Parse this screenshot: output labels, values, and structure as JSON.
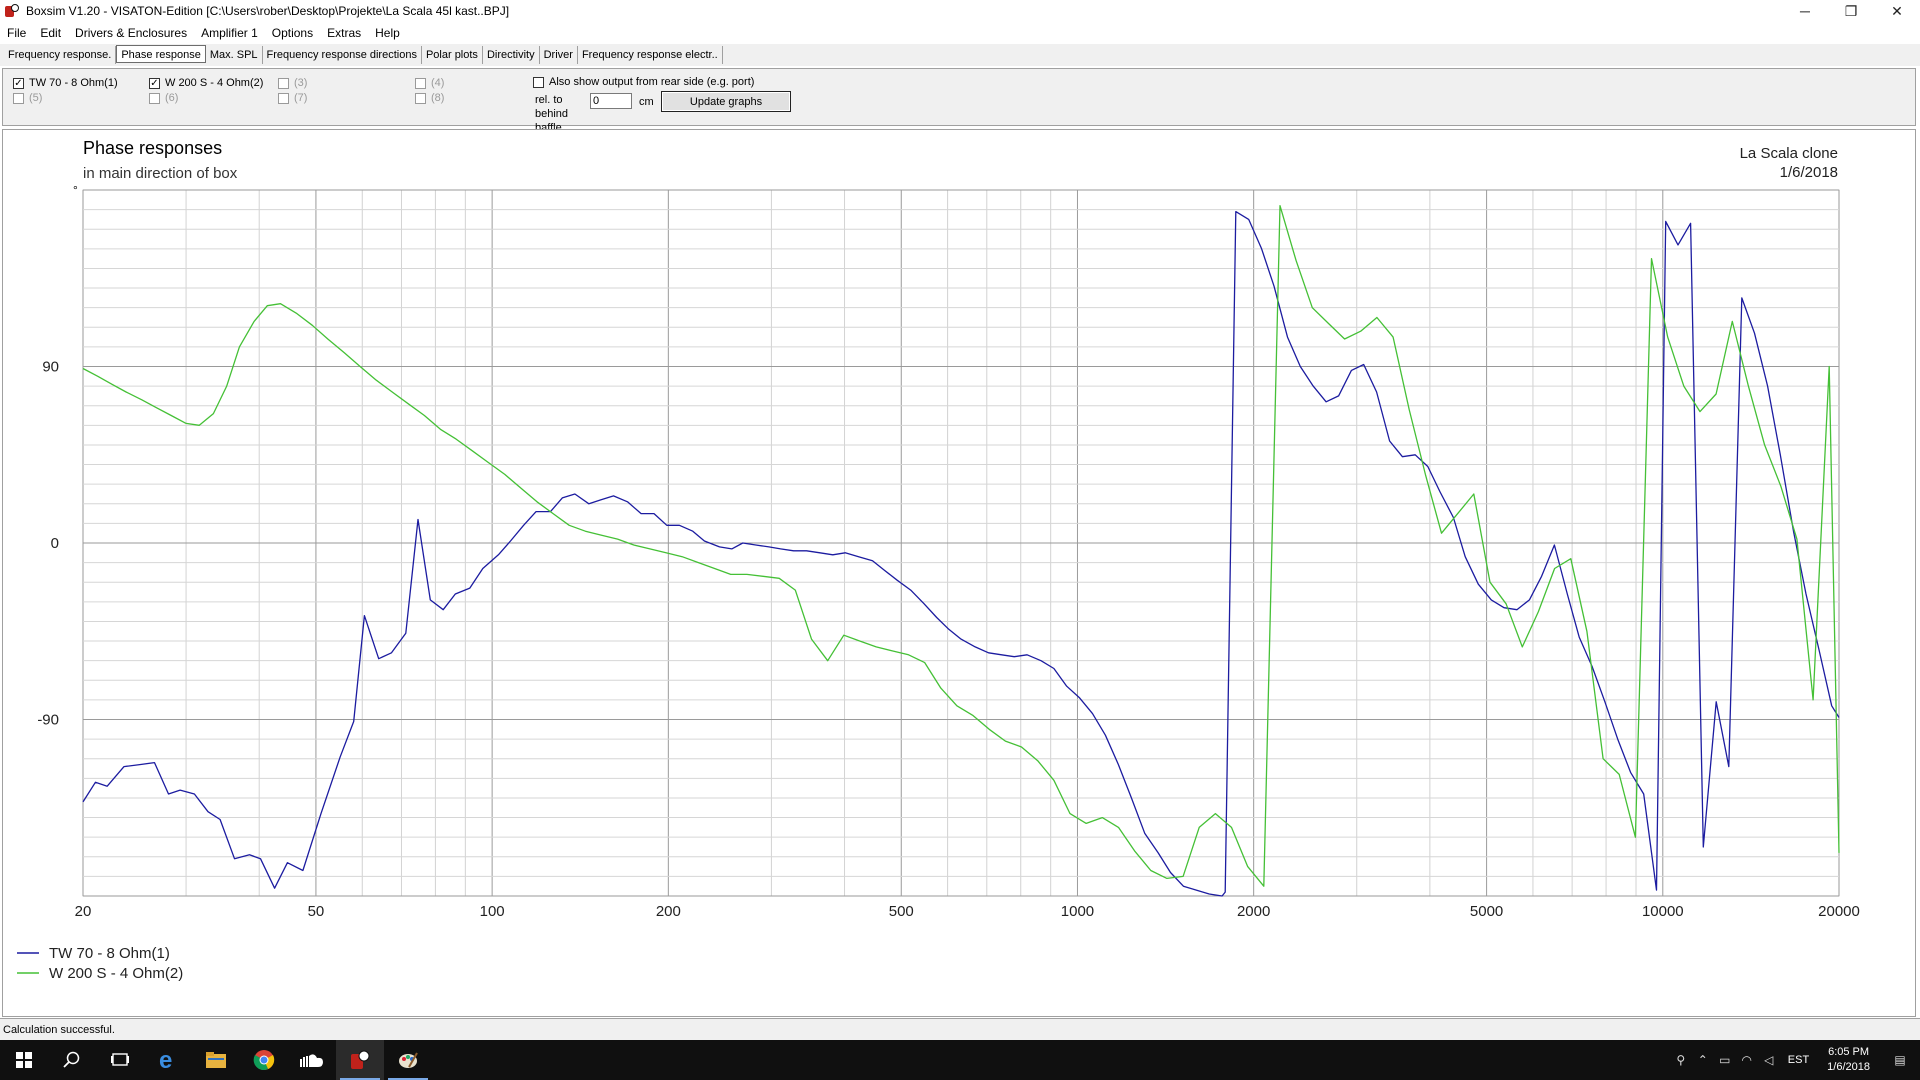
{
  "window": {
    "title": "Boxsim V1.20 - VISATON-Edition [C:\\Users\\rober\\Desktop\\Projekte\\La Scala 45l kast..BPJ]",
    "controls": {
      "minimize": "─",
      "maximize": "❐",
      "close": "✕"
    }
  },
  "menu": [
    "File",
    "Edit",
    "Drivers & Enclosures",
    "Amplifier 1",
    "Options",
    "Extras",
    "Help"
  ],
  "tabs": [
    "Frequency response.",
    "Phase response",
    "Max. SPL",
    "Frequency response directions",
    "Polar plots",
    "Directivity",
    "Driver",
    "Frequency response electr.."
  ],
  "active_tab": "Phase response",
  "drivers": [
    {
      "label": "TW 70 - 8 Ohm(1)",
      "checked": true,
      "enabled": true
    },
    {
      "label": "W 200 S - 4 Ohm(2)",
      "checked": true,
      "enabled": true
    },
    {
      "label": "(3)",
      "checked": false,
      "enabled": false
    },
    {
      "label": "(4)",
      "checked": false,
      "enabled": false
    },
    {
      "label": "(5)",
      "checked": false,
      "enabled": false
    },
    {
      "label": "(6)",
      "checked": false,
      "enabled": false
    },
    {
      "label": "(7)",
      "checked": false,
      "enabled": false
    },
    {
      "label": "(8)",
      "checked": false,
      "enabled": false
    }
  ],
  "rear_option": {
    "label": "Also show output from rear side (e.g. port)",
    "rel_label": "rel. to behind baffle",
    "value": "0",
    "unit": "cm",
    "button": "Update graphs"
  },
  "graph": {
    "project_name": "La Scala clone",
    "date": "1/6/2018",
    "degree_mark": "°"
  },
  "chart_data": {
    "type": "line",
    "title": "Phase responses",
    "subtitle": "in main direction of box",
    "xscale": "log",
    "xlim": [
      20,
      20000
    ],
    "ylim": [
      -180,
      180
    ],
    "x_ticks": [
      "20",
      "50",
      "100",
      "200",
      "500",
      "1000",
      "2000",
      "5000",
      "10000",
      "20000"
    ],
    "y_ticks": [
      "90",
      "0",
      "-90"
    ],
    "grid": true,
    "legend_position": "bottom-left",
    "series": [
      {
        "name": "TW 70 - 8 Ohm(1)",
        "color": "#1c1ca0",
        "points": [
          [
            20,
            -132
          ],
          [
            21,
            -122
          ],
          [
            22,
            -124
          ],
          [
            23.5,
            -114
          ],
          [
            25,
            -113
          ],
          [
            26.5,
            -112
          ],
          [
            28,
            -128
          ],
          [
            29.3,
            -126
          ],
          [
            31,
            -128
          ],
          [
            32.7,
            -137
          ],
          [
            34.3,
            -141
          ],
          [
            36.3,
            -161
          ],
          [
            38.5,
            -159
          ],
          [
            40.2,
            -161
          ],
          [
            42.5,
            -176
          ],
          [
            44.7,
            -163
          ],
          [
            47.5,
            -167
          ],
          [
            51,
            -138
          ],
          [
            55,
            -109
          ],
          [
            58,
            -91
          ],
          [
            60.5,
            -37
          ],
          [
            64,
            -59
          ],
          [
            67.3,
            -56
          ],
          [
            71.2,
            -46
          ],
          [
            74.7,
            12
          ],
          [
            78.4,
            -29
          ],
          [
            82.5,
            -34
          ],
          [
            86.5,
            -26
          ],
          [
            91.6,
            -23
          ],
          [
            96.4,
            -13
          ],
          [
            102.5,
            -6
          ],
          [
            107.5,
            1
          ],
          [
            113.2,
            9
          ],
          [
            118.9,
            16
          ],
          [
            125.8,
            16
          ],
          [
            131.8,
            23
          ],
          [
            138.5,
            25
          ],
          [
            146.3,
            20
          ],
          [
            153.3,
            22
          ],
          [
            161.2,
            24
          ],
          [
            170.3,
            21
          ],
          [
            179.7,
            15
          ],
          [
            189,
            15
          ],
          [
            198.8,
            9
          ],
          [
            208.9,
            9
          ],
          [
            220.2,
            6
          ],
          [
            230.5,
            1
          ],
          [
            244.6,
            -2
          ],
          [
            256.7,
            -3
          ],
          [
            268.1,
            0
          ],
          [
            282.1,
            -1
          ],
          [
            297.1,
            -2
          ],
          [
            311.1,
            -3
          ],
          [
            327.4,
            -4
          ],
          [
            344.5,
            -4
          ],
          [
            363,
            -5
          ],
          [
            382,
            -6
          ],
          [
            401,
            -5
          ],
          [
            422.7,
            -7
          ],
          [
            446.6,
            -9
          ],
          [
            468.4,
            -14
          ],
          [
            492.3,
            -19
          ],
          [
            518.9,
            -24
          ],
          [
            547.1,
            -31
          ],
          [
            574.8,
            -38
          ],
          [
            602.9,
            -44
          ],
          [
            632.4,
            -49
          ],
          [
            668.8,
            -53
          ],
          [
            704.6,
            -56
          ],
          [
            741.9,
            -57
          ],
          [
            779.8,
            -58
          ],
          [
            820.4,
            -57
          ],
          [
            866.3,
            -60
          ],
          [
            911.3,
            -64
          ],
          [
            958.7,
            -73
          ],
          [
            1008.6,
            -79
          ],
          [
            1061.1,
            -87
          ],
          [
            1116.3,
            -98
          ],
          [
            1174.5,
            -113
          ],
          [
            1236.5,
            -130
          ],
          [
            1303,
            -148
          ],
          [
            1374,
            -158
          ],
          [
            1441.9,
            -168
          ],
          [
            1516.9,
            -175
          ],
          [
            1595.9,
            -177
          ],
          [
            1679,
            -179
          ],
          [
            1766.4,
            -180
          ],
          [
            1788,
            -178
          ],
          [
            1864.3,
            169
          ],
          [
            1961,
            165
          ],
          [
            2063.5,
            150
          ],
          [
            2166.7,
            131
          ],
          [
            2284.4,
            105
          ],
          [
            2402.5,
            90
          ],
          [
            2527.4,
            80
          ],
          [
            2659.3,
            72
          ],
          [
            2793.8,
            75
          ],
          [
            2938.2,
            88
          ],
          [
            3083.8,
            91
          ],
          [
            3244,
            77
          ],
          [
            3413.4,
            52
          ],
          [
            3590.7,
            44
          ],
          [
            3775.9,
            45
          ],
          [
            3968.3,
            39
          ],
          [
            4164.7,
            26
          ],
          [
            4387.2,
            13
          ],
          [
            4596.8,
            -7
          ],
          [
            4839.6,
            -21
          ],
          [
            5094.3,
            -29
          ],
          [
            5355.2,
            -33
          ],
          [
            5633.4,
            -34
          ],
          [
            5917.2,
            -29
          ],
          [
            6208.2,
            -17
          ],
          [
            6529.1,
            -1
          ],
          [
            6868.3,
            -26
          ],
          [
            7196.8,
            -48
          ],
          [
            7571.5,
            -63
          ],
          [
            7962.3,
            -81
          ],
          [
            8375,
            -100
          ],
          [
            8811.6,
            -117
          ],
          [
            9277.3,
            -128
          ],
          [
            9757.2,
            -177
          ],
          [
            10115.1,
            164
          ],
          [
            10616.6,
            152
          ],
          [
            11155.3,
            163
          ],
          [
            11727.5,
            -155
          ],
          [
            12336.5,
            -81
          ],
          [
            12964.4,
            -114
          ],
          [
            13644.5,
            125
          ],
          [
            14342.2,
            107
          ],
          [
            15104.5,
            80
          ],
          [
            15877.2,
            45
          ],
          [
            16720.8,
            6
          ],
          [
            17567.3,
            -26
          ],
          [
            18474.1,
            -54
          ],
          [
            19432.5,
            -83
          ],
          [
            20000,
            -89
          ]
        ]
      },
      {
        "name": "W 200 S - 4 Ohm(2)",
        "color": "#45c036",
        "points": [
          [
            20,
            89
          ],
          [
            21.2,
            85
          ],
          [
            22.4,
            81
          ],
          [
            23.7,
            77
          ],
          [
            25.2,
            73
          ],
          [
            26.7,
            69
          ],
          [
            28.3,
            65
          ],
          [
            30,
            61
          ],
          [
            31.6,
            60
          ],
          [
            33.4,
            66
          ],
          [
            35.2,
            80
          ],
          [
            37,
            100
          ],
          [
            39.2,
            113
          ],
          [
            41.3,
            121
          ],
          [
            43.5,
            122
          ],
          [
            46.4,
            117
          ],
          [
            49.3,
            111
          ],
          [
            52.4,
            104
          ],
          [
            55.9,
            97
          ],
          [
            59.5,
            90
          ],
          [
            63.4,
            83
          ],
          [
            67.5,
            77
          ],
          [
            71.9,
            71
          ],
          [
            76.6,
            65
          ],
          [
            81.6,
            58
          ],
          [
            86.8,
            53
          ],
          [
            92.5,
            47
          ],
          [
            98.6,
            41
          ],
          [
            105.1,
            35
          ],
          [
            112,
            28
          ],
          [
            119.3,
            21
          ],
          [
            127.1,
            15
          ],
          [
            135.4,
            9
          ],
          [
            144.3,
            6
          ],
          [
            153.8,
            4
          ],
          [
            163.8,
            2
          ],
          [
            174.6,
            -1
          ],
          [
            186,
            -3
          ],
          [
            198.2,
            -5
          ],
          [
            211.2,
            -7
          ],
          [
            225.1,
            -10
          ],
          [
            239.9,
            -13
          ],
          [
            255.6,
            -16
          ],
          [
            272.4,
            -16
          ],
          [
            290.3,
            -17
          ],
          [
            309.3,
            -18
          ],
          [
            329.6,
            -24
          ],
          [
            351.2,
            -49
          ],
          [
            374.3,
            -60
          ],
          [
            398.9,
            -47
          ],
          [
            425.1,
            -50
          ],
          [
            453,
            -53
          ],
          [
            482.7,
            -55
          ],
          [
            514.4,
            -57
          ],
          [
            548.2,
            -61
          ],
          [
            584.1,
            -74
          ],
          [
            622.4,
            -83
          ],
          [
            663.2,
            -88
          ],
          [
            706.7,
            -95
          ],
          [
            753.1,
            -101
          ],
          [
            802.5,
            -104
          ],
          [
            855.2,
            -111
          ],
          [
            911.3,
            -121
          ],
          [
            971.1,
            -138
          ],
          [
            1034.8,
            -143
          ],
          [
            1102.7,
            -140
          ],
          [
            1175,
            -145
          ],
          [
            1252.1,
            -157
          ],
          [
            1334.3,
            -167
          ],
          [
            1421.8,
            -171
          ],
          [
            1515,
            -170
          ],
          [
            1614.4,
            -145
          ],
          [
            1720.3,
            -138
          ],
          [
            1833.2,
            -145
          ],
          [
            1953.4,
            -165
          ],
          [
            2081.6,
            -175
          ],
          [
            2218.2,
            172
          ],
          [
            2363.7,
            144
          ],
          [
            2518.8,
            120
          ],
          [
            2684,
            112
          ],
          [
            2860.1,
            104
          ],
          [
            3047.7,
            108
          ],
          [
            3247.7,
            115
          ],
          [
            3460.8,
            105
          ],
          [
            3687.8,
            68
          ],
          [
            3929.8,
            35
          ],
          [
            4187.6,
            5
          ],
          [
            4462.4,
            15
          ],
          [
            4755.2,
            25
          ],
          [
            5067.2,
            -20
          ],
          [
            5399.6,
            -31
          ],
          [
            5753.9,
            -53
          ],
          [
            6131.4,
            -35
          ],
          [
            6533.7,
            -13
          ],
          [
            6962.3,
            -8
          ],
          [
            7419.1,
            -45
          ],
          [
            7905.8,
            -110
          ],
          [
            8424.5,
            -118
          ],
          [
            8977.2,
            -150
          ],
          [
            9566.2,
            145
          ],
          [
            10193.8,
            105
          ],
          [
            10862.6,
            80
          ],
          [
            11575.3,
            67
          ],
          [
            12334.8,
            76
          ],
          [
            13144.1,
            113
          ],
          [
            14006.4,
            80
          ],
          [
            14925.3,
            50
          ],
          [
            15904.5,
            29
          ],
          [
            16948,
            2
          ],
          [
            18060,
            -80
          ],
          [
            19244.9,
            90
          ],
          [
            20000,
            -158
          ]
        ]
      }
    ]
  },
  "status": "Calculation successful.",
  "taskbar": {
    "time": "6:05 PM",
    "date": "1/6/2018",
    "lang": "EST",
    "icons": [
      "windows-start-icon",
      "search-icon",
      "task-view-icon",
      "edge-browser-icon",
      "file-explorer-icon",
      "chrome-icon",
      "soundcloud-icon",
      "boxsim-app-icon",
      "paint-app-icon"
    ]
  }
}
